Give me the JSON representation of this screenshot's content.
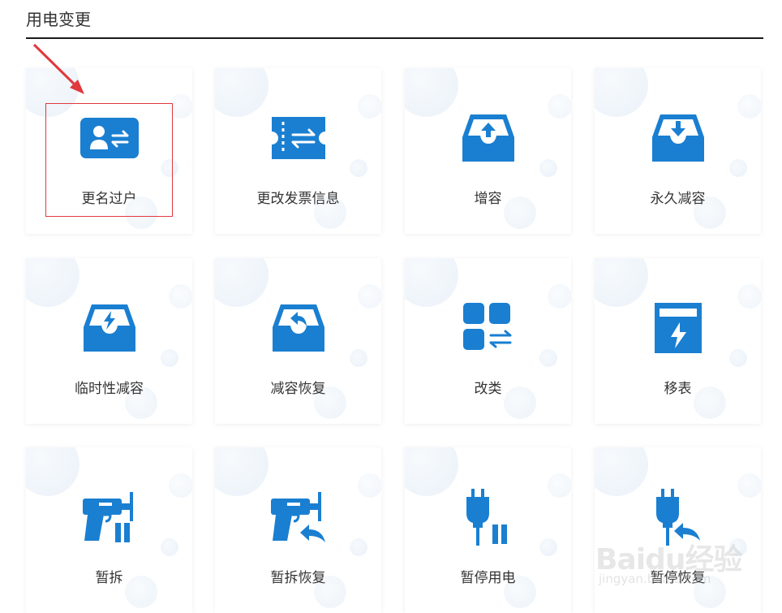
{
  "section": {
    "title": "用电变更"
  },
  "accent_color": "#1a7fd1",
  "annotation": {
    "box_color": "#e0393e",
    "arrow_color": "#e0393e"
  },
  "cards": [
    {
      "label": "更名过户",
      "icon": "user-card-transfer-icon"
    },
    {
      "label": "更改发票信息",
      "icon": "invoice-ticket-icon"
    },
    {
      "label": "增容",
      "icon": "tray-upload-icon"
    },
    {
      "label": "永久减容",
      "icon": "tray-download-icon"
    },
    {
      "label": "临时性减容",
      "icon": "tray-lightning-icon"
    },
    {
      "label": "减容恢复",
      "icon": "tray-restore-icon"
    },
    {
      "label": "改类",
      "icon": "grid-switch-icon"
    },
    {
      "label": "移表",
      "icon": "meter-lightning-icon"
    },
    {
      "label": "暂拆",
      "icon": "drill-icon"
    },
    {
      "label": "暂拆恢复",
      "icon": "drill-restore-icon"
    },
    {
      "label": "暂停用电",
      "icon": "plug-pause-icon"
    },
    {
      "label": "暂停恢复",
      "icon": "plug-restore-icon"
    }
  ],
  "watermark": {
    "logo": "Baidu经验",
    "url": "jingyan.baidu.com"
  }
}
